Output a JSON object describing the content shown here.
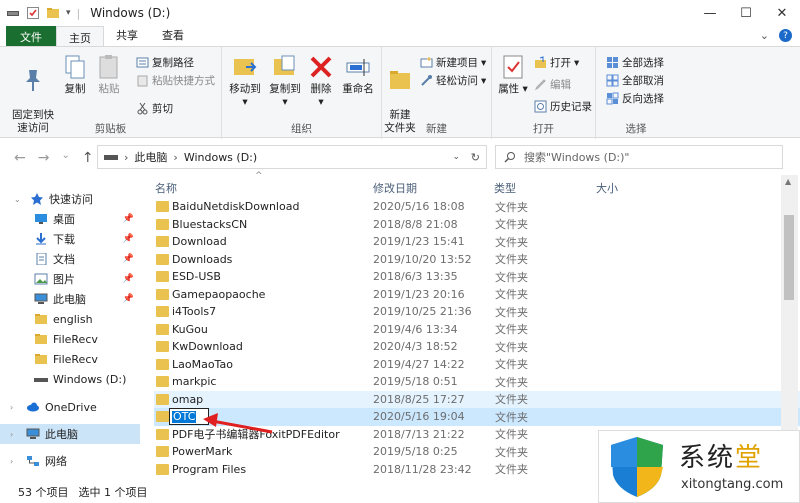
{
  "window": {
    "title": "Windows (D:)",
    "min": "—",
    "max": "☐",
    "close": "✕"
  },
  "tabs": {
    "file": "文件",
    "home": "主页",
    "share": "共享",
    "view": "查看",
    "expand": "⌄",
    "help": "?"
  },
  "ribbon": {
    "pin": "固定到快\n速访问",
    "copy": "复制",
    "paste": "粘贴",
    "copy_path": "复制路径",
    "paste_shortcut": "粘贴快捷方式",
    "cut": "剪切",
    "clipboard": "剪贴板",
    "move_to": "移动到",
    "copy_to": "复制到",
    "delete": "删除",
    "rename": "重命名",
    "organize": "组织",
    "new_folder": "新建\n文件夹",
    "new_item": "新建项目",
    "easy_access": "轻松访问",
    "new": "新建",
    "properties": "属性",
    "open": "打开",
    "edit": "编辑",
    "history": "历史记录",
    "open_group": "打开",
    "select_all": "全部选择",
    "select_none": "全部取消",
    "invert": "反向选择",
    "select": "选择"
  },
  "address": {
    "back": "←",
    "forward": "→",
    "up_list": "⌄",
    "up": "↑",
    "path": [
      "此电脑",
      "Windows (D:)"
    ],
    "search_placeholder": "搜索\"Windows (D:)\""
  },
  "nav": [
    {
      "label": "快速访问",
      "icon": "star-icon",
      "pinned": false
    },
    {
      "label": "桌面",
      "icon": "desktop-icon",
      "pinned": true
    },
    {
      "label": "下载",
      "icon": "download-icon",
      "pinned": true
    },
    {
      "label": "文档",
      "icon": "document-icon",
      "pinned": true
    },
    {
      "label": "图片",
      "icon": "picture-icon",
      "pinned": true
    },
    {
      "label": "此电脑",
      "icon": "computer-icon",
      "pinned": true
    },
    {
      "label": "english",
      "icon": "folder-icon",
      "pinned": false
    },
    {
      "label": "FileRecv",
      "icon": "folder-icon",
      "pinned": false
    },
    {
      "label": "FileRecv",
      "icon": "folder-icon",
      "pinned": false
    },
    {
      "label": "Windows (D:)",
      "icon": "drive-icon",
      "pinned": false
    },
    {
      "label": "OneDrive",
      "icon": "cloud-icon",
      "pinned": false
    },
    {
      "label": "此电脑",
      "icon": "computer-icon",
      "pinned": false
    },
    {
      "label": "网络",
      "icon": "network-icon",
      "pinned": false
    }
  ],
  "columns": {
    "name": "名称",
    "date": "修改日期",
    "type": "类型",
    "size": "大小"
  },
  "files": [
    {
      "name": "BaiduNetdiskDownload",
      "date": "2020/5/16 18:08",
      "type": "文件夹"
    },
    {
      "name": "BluestacksCN",
      "date": "2018/8/8 21:08",
      "type": "文件夹"
    },
    {
      "name": "Download",
      "date": "2019/1/23 15:41",
      "type": "文件夹"
    },
    {
      "name": "Downloads",
      "date": "2019/10/20 13:52",
      "type": "文件夹"
    },
    {
      "name": "ESD-USB",
      "date": "2018/6/3 13:35",
      "type": "文件夹"
    },
    {
      "name": "Gamepaopaoche",
      "date": "2019/1/23 20:16",
      "type": "文件夹"
    },
    {
      "name": "i4Tools7",
      "date": "2019/10/25 21:36",
      "type": "文件夹"
    },
    {
      "name": "KuGou",
      "date": "2019/4/6 13:34",
      "type": "文件夹"
    },
    {
      "name": "KwDownload",
      "date": "2020/4/3 18:52",
      "type": "文件夹"
    },
    {
      "name": "LaoMaoTao",
      "date": "2019/4/27 14:22",
      "type": "文件夹"
    },
    {
      "name": "markpic",
      "date": "2019/5/18 0:51",
      "type": "文件夹"
    },
    {
      "name": "omap",
      "date": "2018/8/25 17:27",
      "type": "文件夹"
    },
    {
      "name": "OTC",
      "date": "2020/5/16 19:04",
      "type": "文件夹"
    },
    {
      "name": "PDF电子书编辑器FoxitPDFEditor",
      "date": "2018/7/13 21:22",
      "type": "文件夹"
    },
    {
      "name": "PowerMark",
      "date": "2019/5/18 0:25",
      "type": "文件夹"
    },
    {
      "name": "Program Files",
      "date": "2018/11/28 23:42",
      "type": "文件夹"
    }
  ],
  "status": {
    "count": "53 个项目",
    "selected": "选中 1 个项目"
  },
  "watermark": {
    "brand_a": "系统",
    "brand_b": "堂",
    "site": "xitongtang.com"
  },
  "colors": {
    "file_tab": "#1a6e2f",
    "folder": "#e9c250",
    "selection": "#cce8ff",
    "accent": "#0078d7"
  }
}
